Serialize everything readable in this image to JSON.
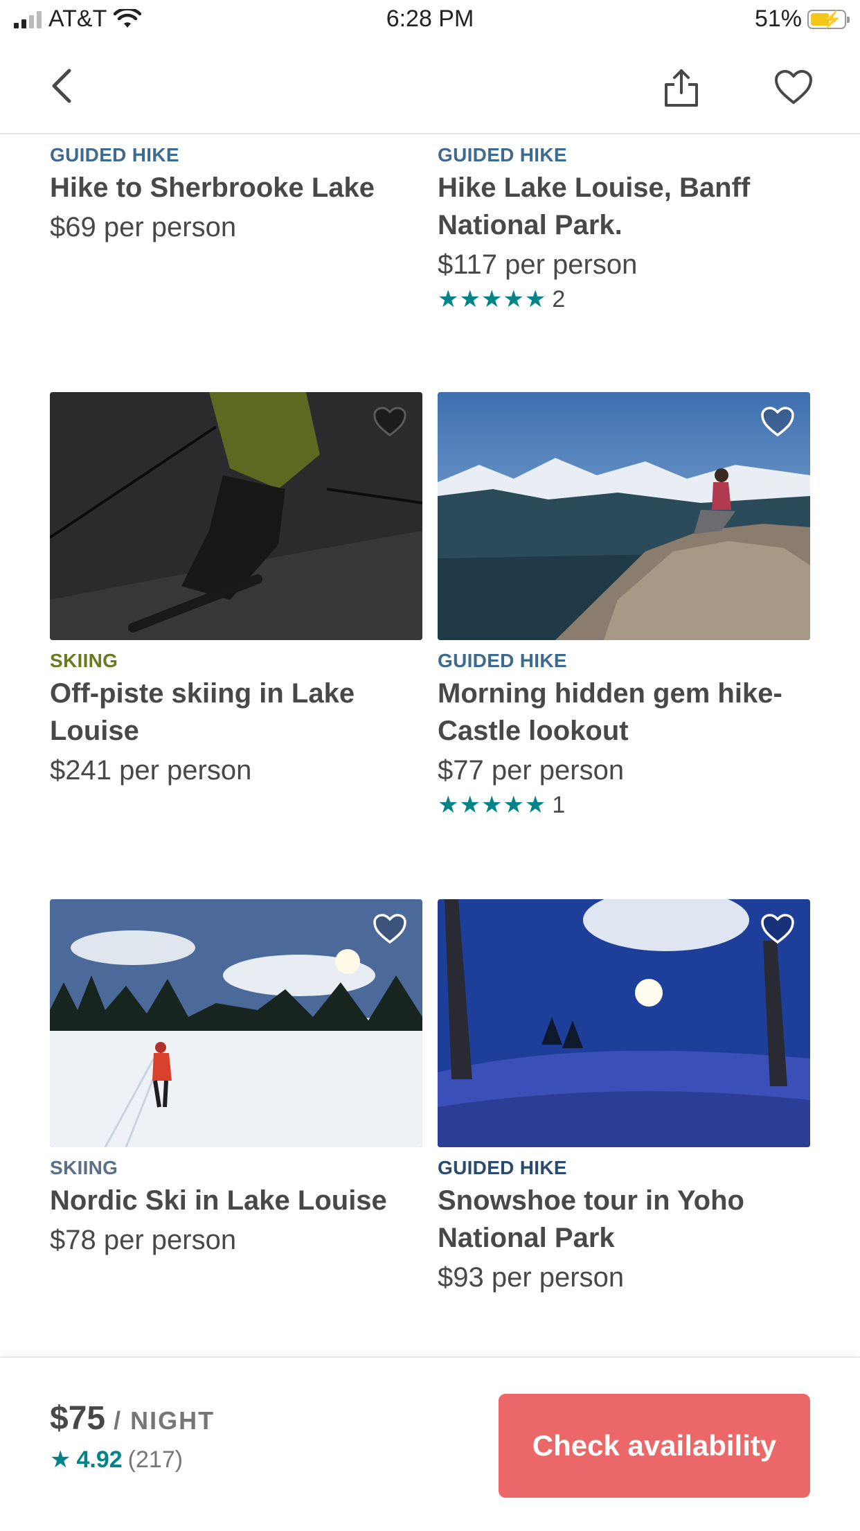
{
  "status_bar": {
    "carrier": "AT&T",
    "time": "6:28 PM",
    "battery": "51%"
  },
  "nav": {
    "back_icon": "chevron-left-icon",
    "share_icon": "share-icon",
    "favorite_icon": "heart-icon"
  },
  "listings": [
    {
      "category": "GUIDED HIKE",
      "title": "Hike to Sherbrooke Lake",
      "price": "$69 per person"
    },
    {
      "category": "GUIDED HIKE",
      "title": "Hike Lake Louise, Banff National Park.",
      "price": "$117 per person",
      "stars": "★★★★★",
      "review_count": "2"
    },
    {
      "category": "SKIING",
      "title": "Off-piste skiing in Lake Louise",
      "price": "$241 per person"
    },
    {
      "category": "GUIDED HIKE",
      "title": "Morning hidden gem hike- Castle lookout",
      "price": "$77 per person",
      "stars": "★★★★★",
      "review_count": "1"
    },
    {
      "category": "SKIING",
      "title": "Nordic Ski in Lake Louise",
      "price": "$78 per person"
    },
    {
      "category": "GUIDED HIKE",
      "title": "Snowshoe tour in Yoho National Park",
      "price": "$93 per person"
    }
  ],
  "colors": {
    "category_skiing": "#6b7a1f",
    "category_hike": "#3d6b8f",
    "star": "#008489",
    "cta": "#ec6767"
  },
  "booking": {
    "price": "$75",
    "unit": " / NIGHT",
    "star": "★",
    "rating": "4.92",
    "reviews": "(217)",
    "cta_label": "Check availability"
  }
}
